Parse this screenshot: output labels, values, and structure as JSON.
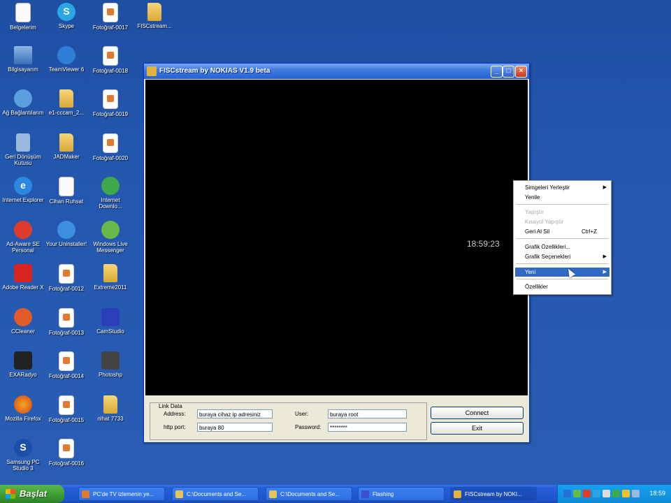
{
  "desktop": {
    "icons": [
      {
        "label": "Belgelerim",
        "icon": "documents-icon"
      },
      {
        "label": "Skype",
        "icon": "skype-icon"
      },
      {
        "label": "Fotoğraf-0017",
        "icon": "image-file-icon"
      },
      {
        "label": "FISCstream...",
        "icon": "folder-icon"
      },
      {
        "label": "Bilgisayarım",
        "icon": "computer-icon"
      },
      {
        "label": "TeamViewer 6",
        "icon": "teamviewer-icon"
      },
      {
        "label": "Fotoğraf-0018",
        "icon": "image-file-icon"
      },
      {
        "label": "Ağ Bağlantılarım",
        "icon": "network-icon"
      },
      {
        "label": "e1-cccam_2...",
        "icon": "folder-icon"
      },
      {
        "label": "Fotoğraf-0019",
        "icon": "image-file-icon"
      },
      {
        "label": "Geri Dönüşüm Kutusu",
        "icon": "recycle-bin-icon"
      },
      {
        "label": "JADMaker",
        "icon": "folder-icon"
      },
      {
        "label": "Fotoğraf-0020",
        "icon": "image-file-icon"
      },
      {
        "label": "Internet Explorer",
        "icon": "internet-explorer-icon"
      },
      {
        "label": "Cihan Ruhsat",
        "icon": "document-icon"
      },
      {
        "label": "Internet Downlo...",
        "icon": "download-manager-icon"
      },
      {
        "label": "Ad-Aware SE Personal",
        "icon": "adaware-icon"
      },
      {
        "label": "Your Uninstaller!",
        "icon": "uninstaller-icon"
      },
      {
        "label": "Windows Live Messenger",
        "icon": "messenger-icon"
      },
      {
        "label": "Adobe Reader X",
        "icon": "adobe-reader-icon"
      },
      {
        "label": "Fotoğraf-0012",
        "icon": "image-file-icon"
      },
      {
        "label": "Extreme2011",
        "icon": "folder-icon"
      },
      {
        "label": "CCleaner",
        "icon": "ccleaner-icon"
      },
      {
        "label": "Fotoğraf-0013",
        "icon": "image-file-icon"
      },
      {
        "label": "CamStudio",
        "icon": "camstudio-icon"
      },
      {
        "label": "EXARadyo",
        "icon": "radio-icon"
      },
      {
        "label": "Fotoğraf-0014",
        "icon": "image-file-icon"
      },
      {
        "label": "Photoshp",
        "icon": "photoshop-icon"
      },
      {
        "label": "Mozilla Firefox",
        "icon": "firefox-icon"
      },
      {
        "label": "Fotoğraf-0015",
        "icon": "image-file-icon"
      },
      {
        "label": "nihat 7733",
        "icon": "folder-icon"
      },
      {
        "label": "Samsung PC Studio 3",
        "icon": "samsung-icon"
      },
      {
        "label": "Fotoğraf-0016",
        "icon": "image-file-icon"
      }
    ]
  },
  "window": {
    "title": "FISCstream  by NOKIAS V1.9 beta",
    "clock": "18:59:23",
    "panel": {
      "group_label": "Link Data",
      "address_label": "Address:",
      "address_value": "buraya cihaz ip adresiniz",
      "port_label": "http port:",
      "port_value": "buraya 80",
      "user_label": "User:",
      "user_value": "buraya root",
      "password_label": "Password:",
      "password_value": "********",
      "connect_label": "Connect",
      "exit_label": "Exit"
    }
  },
  "context_menu": {
    "items": [
      {
        "label": "Simgeleri Yerleştir",
        "submenu": true
      },
      {
        "label": "Yenile"
      },
      {
        "label": "Yapıştır",
        "disabled": true
      },
      {
        "label": "Kısayol Yapıştır",
        "disabled": true
      },
      {
        "label": "Geri Al Sil",
        "shortcut": "Ctrl+Z"
      },
      {
        "label": "Grafik Özellikleri..."
      },
      {
        "label": "Grafik Seçenekleri",
        "submenu": true
      },
      {
        "label": "Yeni",
        "submenu": true,
        "selected": true
      },
      {
        "label": "Özellikler"
      }
    ]
  },
  "taskbar": {
    "start_label": "Başlat",
    "tasks": [
      {
        "label": "PC'de TV izlemenin ye..."
      },
      {
        "label": "C:\\Documents and Se..."
      },
      {
        "label": "C:\\Documents and Se..."
      },
      {
        "label": "Flashing"
      },
      {
        "label": "FISCstream  by NOKI..."
      }
    ],
    "clock": "18:59"
  },
  "colors": {
    "desktop_bg": "#2458b0",
    "titlebar": "#2462d2",
    "menu_highlight": "#316ac5",
    "start_button": "#3c9a33"
  }
}
